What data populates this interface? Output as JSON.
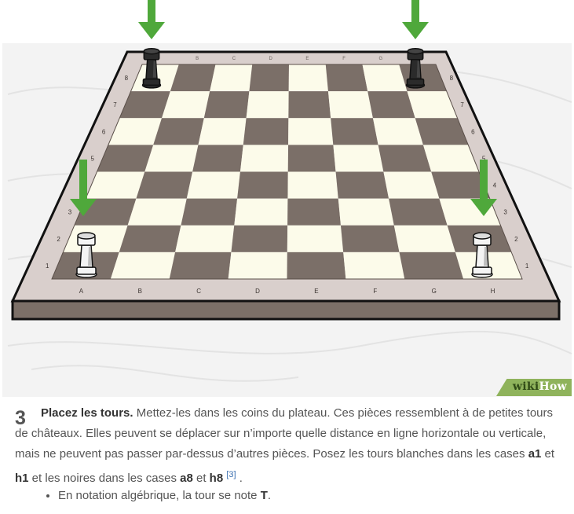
{
  "image": {
    "files_top": [
      "B",
      "C",
      "D",
      "E",
      "F",
      "G"
    ],
    "files_bottom": [
      "A",
      "B",
      "C",
      "D",
      "E",
      "F",
      "G",
      "H"
    ],
    "ranks": [
      "1",
      "2",
      "3",
      "4",
      "5",
      "6",
      "7",
      "8"
    ],
    "colors": {
      "light_square": "#fcfbea",
      "dark_square": "#7b6f68",
      "frame": "#d9cfcc",
      "frame_edge": "#7c7068",
      "arrow": "#4fa83b",
      "background": "#f3f3f3"
    },
    "icons": [
      "black-rook-icon",
      "white-rook-icon",
      "green-arrow-icon"
    ],
    "watermark": {
      "part1": "wiki",
      "part2": "How"
    }
  },
  "step": {
    "number": "3",
    "title": "Placez les tours.",
    "text1": " Mettez-les dans les coins du plateau. Ces pièces ressemblent à de petites tours de châteaux. Elles peuvent se déplacer sur n’importe quelle distance en ligne horizontale ou verticale, mais ne peuvent pas passer par-dessus d’autres pièces. Posez les tours blanches dans les cases ",
    "sq1": "a1",
    "and1": " et ",
    "sq2": "h1",
    "text2": " et les noires dans les cases ",
    "sq3": "a8",
    "and2": " et ",
    "sq4": "h8",
    "ref": "[3]",
    "end": " ."
  },
  "bullets": [
    {
      "prefix": "En notation algébrique, la tour se note ",
      "bold": "T",
      "suffix": "."
    }
  ]
}
